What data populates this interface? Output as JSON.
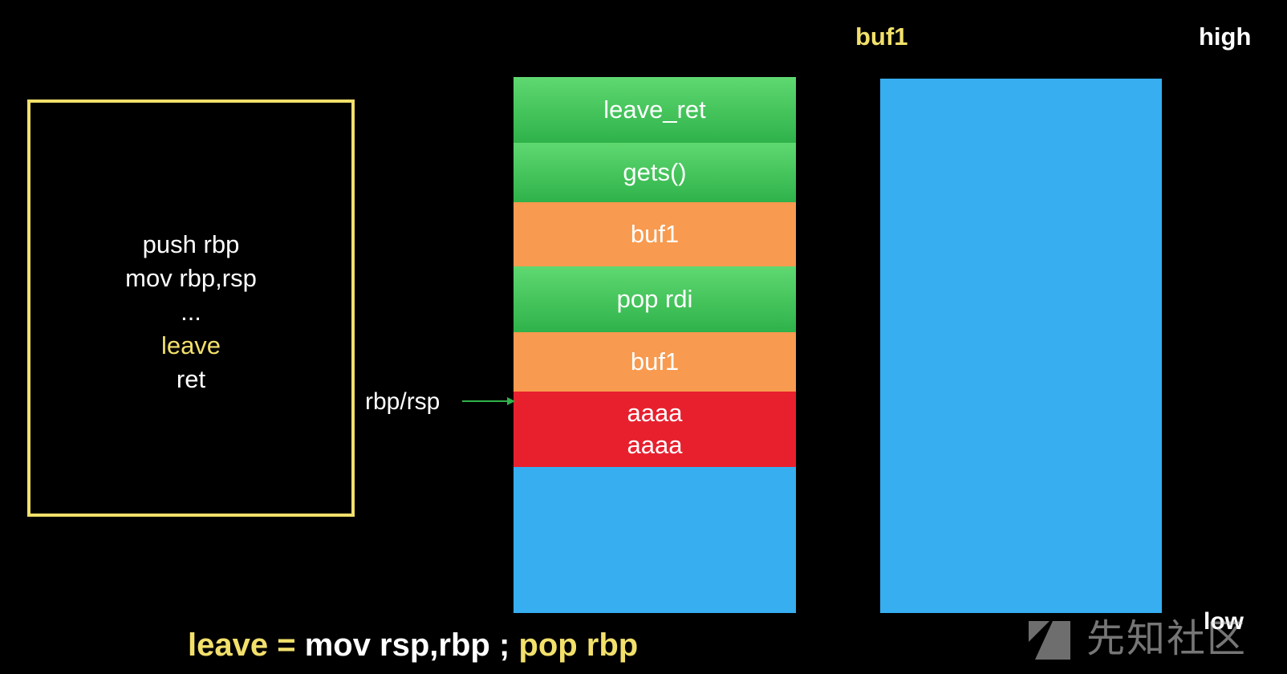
{
  "labels": {
    "buf1_top": "buf1",
    "high": "high",
    "low": "low",
    "pointer": "rbp/rsp"
  },
  "code": {
    "lines": [
      {
        "text": "push rbp",
        "highlight": false
      },
      {
        "text": "mov rbp,rsp",
        "highlight": false
      },
      {
        "text": "...",
        "highlight": false
      },
      {
        "text": "leave",
        "highlight": true
      },
      {
        "text": "ret",
        "highlight": false
      }
    ]
  },
  "stack": {
    "slots": [
      {
        "lines": [
          "leave_ret"
        ],
        "color": "green"
      },
      {
        "lines": [
          "gets()"
        ],
        "color": "green"
      },
      {
        "lines": [
          "buf1"
        ],
        "color": "orange"
      },
      {
        "lines": [
          "pop rdi"
        ],
        "color": "green"
      },
      {
        "lines": [
          "buf1"
        ],
        "color": "orange"
      },
      {
        "lines": [
          "aaaa",
          "aaaa"
        ],
        "color": "red"
      },
      {
        "lines": [],
        "color": "blue"
      }
    ]
  },
  "formula": {
    "parts": [
      {
        "text": "leave = ",
        "color": "yellow"
      },
      {
        "text": "mov rsp,rbp ; ",
        "color": "white"
      },
      {
        "text": "pop rbp",
        "color": "yellow"
      }
    ]
  },
  "watermark": {
    "text": "先知社区"
  },
  "colors": {
    "yellow": "#f2e06b",
    "green": "#3cc255",
    "orange": "#f89a4f",
    "red": "#e8202e",
    "blue": "#36aef0",
    "background": "#000000",
    "arrow": "#2fb24a"
  }
}
